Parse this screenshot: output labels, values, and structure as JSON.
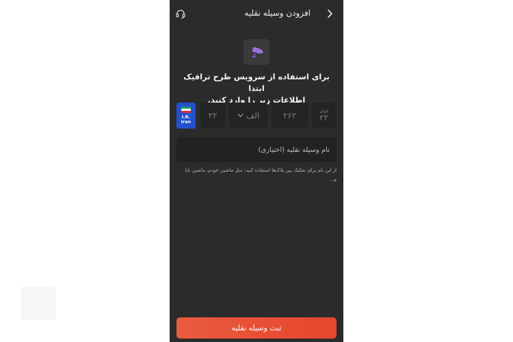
{
  "header": {
    "title": "افزودن وسیله نقلیه",
    "back_icon": "chevron-right-icon",
    "support_icon": "headset-icon"
  },
  "hero": {
    "icon": "traffic-camera-icon"
  },
  "intro": {
    "line1": "برای استفاده از سرویس طرح ترافیک ابتدا",
    "line2": "اطلاعات زیر را وارد کنید."
  },
  "plate": {
    "country": {
      "line1": "I.R.",
      "line2": "Iran"
    },
    "part1_placeholder": "۲۲",
    "letter_value": "الف",
    "part3_placeholder": "۲۶۲",
    "region_label": "ایران",
    "region_placeholder": "۲۲"
  },
  "vehicle_name": {
    "placeholder": "نام وسیله نقلیه (اختیاری)",
    "hint": "از این نام برای تفکیک بین پلاک‌ها استفاده کنید؛ مثل ماشین خودم، ماشین بابا و..."
  },
  "submit": {
    "label": "ثبت وسیله نقلیه"
  },
  "colors": {
    "background": "#2b2b2b",
    "field": "#232323",
    "accent": "#e6462c",
    "plate_blue": "#2251d0"
  }
}
